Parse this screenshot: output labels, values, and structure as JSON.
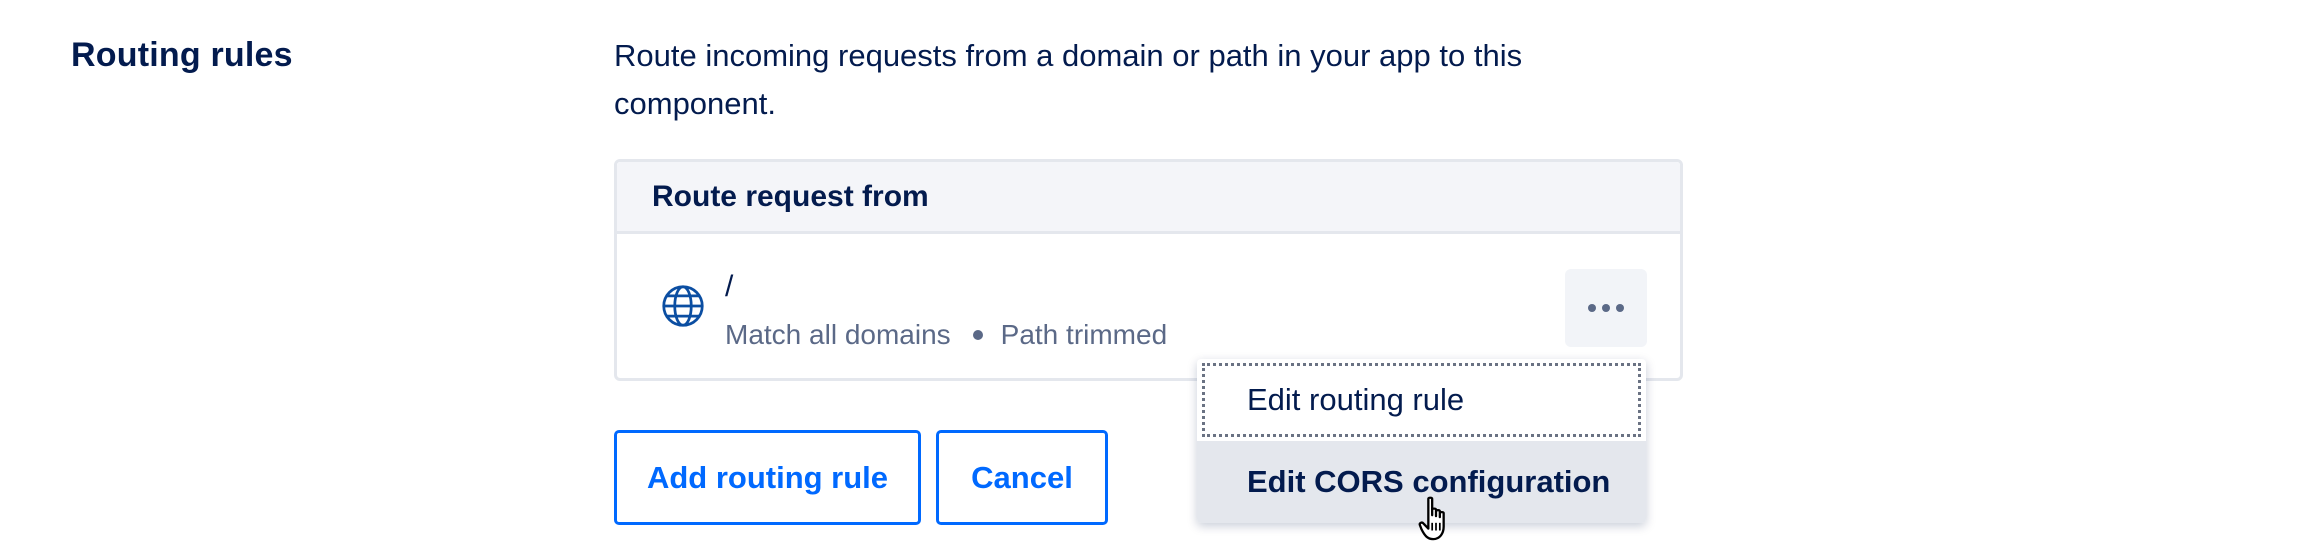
{
  "section": {
    "title": "Routing rules",
    "description": "Route incoming requests from a domain or path in your app to this component."
  },
  "routes": {
    "header": "Route request from",
    "rows": [
      {
        "icon": "globe-icon",
        "path": "/",
        "domain": "Match all domains",
        "trim": "Path trimmed"
      }
    ]
  },
  "actions": {
    "add_label": "Add routing rule",
    "cancel_label": "Cancel"
  },
  "menu": {
    "items": [
      {
        "label": "Edit routing rule",
        "state": "focused"
      },
      {
        "label": "Edit CORS configuration",
        "state": "hovered"
      }
    ]
  },
  "colors": {
    "text": "#031b4e",
    "muted": "#5b6987",
    "accent": "#0069ff",
    "border": "#e4e7ed",
    "header_bg": "#f4f5f9"
  }
}
